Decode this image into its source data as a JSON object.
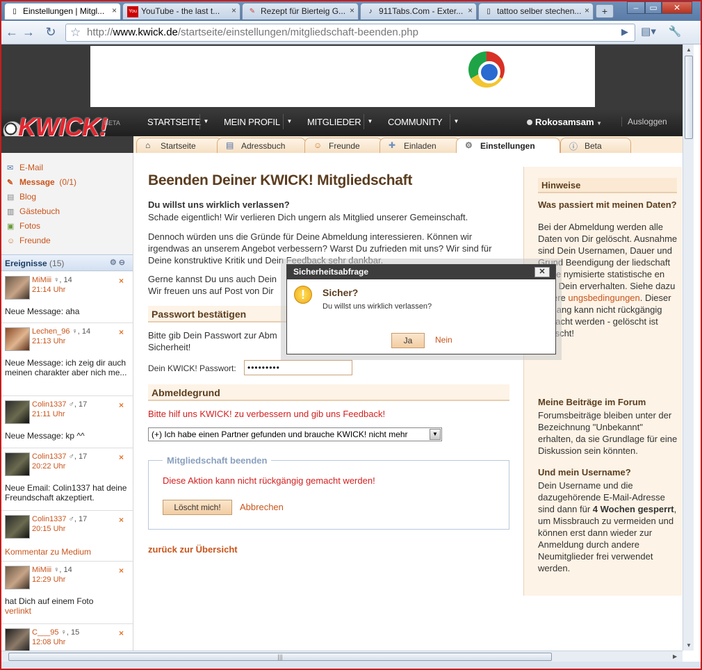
{
  "browser": {
    "tabs": [
      {
        "title": "Einstellungen | Mitgl...",
        "favicon": "page-icon",
        "active": true
      },
      {
        "title": "YouTube - the last t...",
        "favicon": "youtube-icon",
        "active": false
      },
      {
        "title": "Rezept für Bierteig G...",
        "favicon": "recipe-icon",
        "active": false
      },
      {
        "title": "911Tabs.Com - Exter...",
        "favicon": "guitar-icon",
        "active": false
      },
      {
        "title": "tattoo selber stechen...",
        "favicon": "page-icon",
        "active": false
      }
    ],
    "new_tab_symbol": "+",
    "url_prefix": "http://",
    "url_domain": "www.kwick.de",
    "url_path": "/startseite/einstellungen/mitgliedschaft-beenden.php"
  },
  "header": {
    "logo": "KWICK!",
    "beta": "BETA",
    "nav": [
      "STARTSEITE",
      "MEIN PROFIL",
      "MITGLIEDER",
      "COMMUNITY"
    ],
    "username": "Rokosamsam",
    "logout": "Ausloggen"
  },
  "subtabs": [
    {
      "label": "Startseite",
      "icon": "home-icon"
    },
    {
      "label": "Adressbuch",
      "icon": "addressbook-icon"
    },
    {
      "label": "Freunde",
      "icon": "friends-icon"
    },
    {
      "label": "Einladen",
      "icon": "invite-icon"
    },
    {
      "label": "Einstellungen",
      "icon": "gear-icon",
      "active": true
    },
    {
      "label": "Beta",
      "icon": "info-icon"
    }
  ],
  "sidebar": {
    "links": [
      {
        "label": "E-Mail",
        "icon": "email-icon"
      },
      {
        "label": "Message",
        "count": "(0/1)",
        "icon": "message-icon",
        "bold": true
      },
      {
        "label": "Blog",
        "icon": "blog-icon"
      },
      {
        "label": "Gästebuch",
        "icon": "guestbook-icon"
      },
      {
        "label": "Fotos",
        "icon": "photos-icon"
      },
      {
        "label": "Freunde",
        "icon": "friends-icon"
      }
    ],
    "events_title": "Ereignisse",
    "events_count": "(15)",
    "events": [
      {
        "name": "MiMiii",
        "meta": "♀, 14",
        "time": "21:14 Uhr",
        "text": "Neue Message: aha"
      },
      {
        "name": "Lechen_96",
        "meta": "♀, 14",
        "time": "21:13 Uhr",
        "text": "Neue Message: ich zeig dir auch meinen charakter aber nich me..."
      },
      {
        "name": "Colin1337",
        "meta": "♂, 17",
        "time": "21:11 Uhr",
        "text": "Neue Message: kp ^^"
      },
      {
        "name": "Colin1337",
        "meta": "♂, 17",
        "time": "20:22 Uhr",
        "text": "Neue Email: Colin1337 hat deine Freundschaft akzeptiert."
      },
      {
        "name": "Colin1337",
        "meta": "♂, 17",
        "time": "20:15 Uhr",
        "text": "Kommentar zu Medium"
      },
      {
        "name": "MiMiii",
        "meta": "♀, 14",
        "time": "12:29 Uhr",
        "text": "hat Dich auf einem Foto",
        "text2": "verlinkt"
      },
      {
        "name": "C___95",
        "meta": "♀, 15",
        "time": "12:08 Uhr",
        "text": ""
      }
    ]
  },
  "main": {
    "title": "Beenden Deiner KWICK! Mitgliedschaft",
    "q1": "Du willst uns wirklich verlassen?",
    "p1": "Schade eigentlich! Wir verlieren Dich ungern als Mitglied unserer Gemeinschaft.",
    "p2": "Dennoch würden uns die Gründe für Deine Abmeldung interessieren. Können wir irgendwas an unserem Angebot verbessern? Warst Du zufrieden mit uns? Wir sind für Deine konstruktive Kritik und Dein Feedback sehr dankbar.",
    "p3a": "Gerne kannst Du uns auch Dein",
    "p3b": "Wir freuen uns auf Post von Dir",
    "pw_section": "Passwort bestätigen",
    "pw_text_a": "Bitte gib Dein Passwort zur Abm",
    "pw_text_b": "Sicherheit!",
    "pw_label": "Dein KWICK! Passwort:",
    "pw_value": "•••••••••",
    "reason_section": "Abmeldegrund",
    "reason_hint": "Bitte hilf uns KWICK! zu verbessern und gib uns Feedback!",
    "reason_selected": "(+) Ich habe einen Partner gefunden und brauche KWICK! nicht mehr",
    "end_legend": "Mitgliedschaft beenden",
    "end_warning": "Diese Aktion kann nicht rückgängig gemacht werden!",
    "delete_button": "Löscht mich!",
    "cancel_link": "Abbrechen",
    "back_link": "zurück zur Übersicht"
  },
  "hints": {
    "title": "Hinweise",
    "q1": "Was passiert mit meinen Daten?",
    "t1a": "Bei der Abmeldung werden alle Daten von Dir gelöscht. Ausnahme sind Dein Usernamen, Dauer und Grund",
    "t1b": "Beendigung der",
    "t1c": "liedschaft sowie",
    "t1d": "nymisierte statistische",
    "t1e": "en über Dein",
    "t1f": "erverhalten. Siehe dazu",
    "t1g": "unsere",
    "t1h": "ungsbedingungen",
    "t1i": ". Dieser Vorgang kann nicht rückgängig gemacht werden - gelöscht ist gelöscht!",
    "q2": "Meine Beiträge im Forum",
    "t2": "Forumsbeiträge bleiben unter der Bezeichnung \"Unbekannt\" erhalten, da sie Grundlage für eine Diskussion sein könnten.",
    "q3": "Und mein Username?",
    "t3a": "Dein Username und die dazugehörende E-Mail-Adresse sind dann für",
    "t3b": "4 Wochen gesperrt",
    "t3c": ", um Missbrauch zu vermeiden und können erst dann wieder zur Anmeldung durch andere Neumitglieder frei verwendet werden."
  },
  "dialog": {
    "title": "Sicherheitsabfrage",
    "question": "Sicher?",
    "text": "Du willst uns wirklich verlassen?",
    "yes": "Ja",
    "no": "Nein"
  }
}
